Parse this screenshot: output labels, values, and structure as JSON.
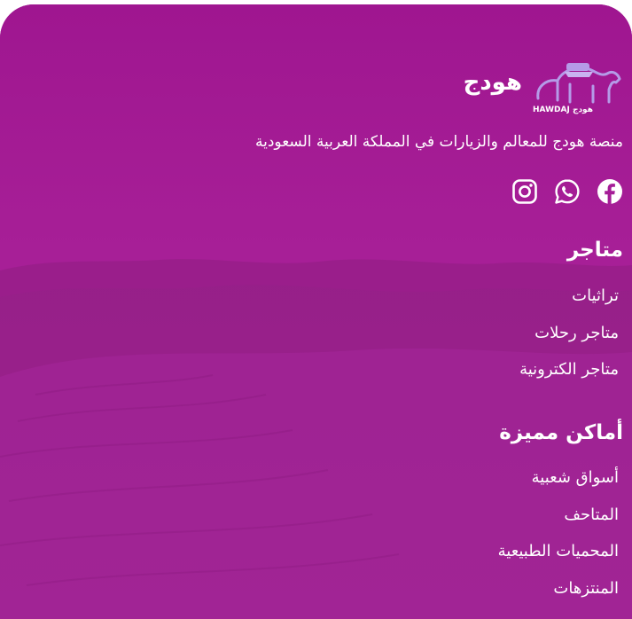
{
  "brand": {
    "name": "هودج",
    "logo_text": "HAWDAJ هودج"
  },
  "tagline": "منصة هودج للمعالم والزيارات في المملكة العربية السعودية",
  "socials": [
    {
      "icon": "facebook-icon"
    },
    {
      "icon": "whatsapp-icon"
    },
    {
      "icon": "instagram-icon"
    }
  ],
  "stores": {
    "title": "متاجر",
    "items": [
      "تراثيات",
      "متاجر رحلات",
      "متاجر الكترونية"
    ]
  },
  "places": {
    "title": "أماكن مميزة",
    "items": [
      "أسواق شعبية",
      "المتاحف",
      "المحميات الطبيعية",
      "المنتزهات"
    ]
  },
  "colors": {
    "background": "#a51d97",
    "text": "#ffffff",
    "logo_accent": "#b59be8"
  }
}
